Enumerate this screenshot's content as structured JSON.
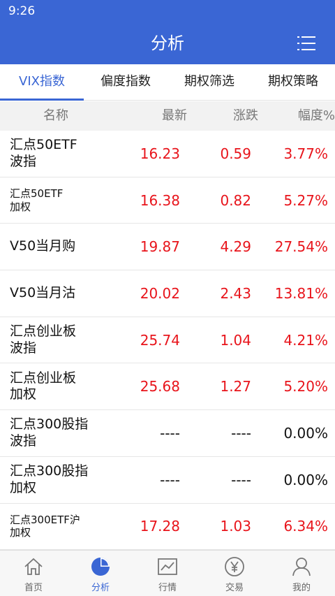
{
  "status_bar": {
    "time": "9:26"
  },
  "header": {
    "title": "分析",
    "menu_icon": "menu-icon"
  },
  "tabs": [
    {
      "label": "VIX指数",
      "active": true
    },
    {
      "label": "偏度指数",
      "active": false
    },
    {
      "label": "期权筛选",
      "active": false
    },
    {
      "label": "期权策略",
      "active": false
    }
  ],
  "table": {
    "headers": {
      "name": "名称",
      "latest": "最新",
      "change": "涨跌",
      "pct": "幅度%"
    },
    "rows": [
      {
        "name_line1": "汇点50ETF",
        "name_line2": "波指",
        "latest": "16.23",
        "change": "0.59",
        "pct": "3.77%",
        "color": "#e8141b"
      },
      {
        "name_line1": "汇点50ETF",
        "name_line2": "加权",
        "latest": "16.38",
        "change": "0.82",
        "pct": "5.27%",
        "color": "#e8141b"
      },
      {
        "name_line1": "V50当月购",
        "name_line2": "",
        "latest": "19.87",
        "change": "4.29",
        "pct": "27.54%",
        "color": "#e8141b"
      },
      {
        "name_line1": "V50当月沽",
        "name_line2": "",
        "latest": "20.02",
        "change": "2.43",
        "pct": "13.81%",
        "color": "#e8141b"
      },
      {
        "name_line1": "汇点创业板",
        "name_line2": "波指",
        "latest": "25.74",
        "change": "1.04",
        "pct": "4.21%",
        "color": "#e8141b"
      },
      {
        "name_line1": "汇点创业板",
        "name_line2": "加权",
        "latest": "25.68",
        "change": "1.27",
        "pct": "5.20%",
        "color": "#e8141b"
      },
      {
        "name_line1": "汇点300股指",
        "name_line2": "波指",
        "latest": "----",
        "change": "----",
        "pct": "0.00%",
        "color": "#111111"
      },
      {
        "name_line1": "汇点300股指",
        "name_line2": "加权",
        "latest": "----",
        "change": "----",
        "pct": "0.00%",
        "color": "#111111"
      },
      {
        "name_line1": "汇点300ETF沪",
        "name_line2": "加权",
        "latest": "17.28",
        "change": "1.03",
        "pct": "6.34%",
        "color": "#e8141b"
      }
    ]
  },
  "bottom_nav": [
    {
      "label": "首页",
      "icon": "home-icon",
      "active": false
    },
    {
      "label": "分析",
      "icon": "pie-chart-icon",
      "active": true
    },
    {
      "label": "行情",
      "icon": "line-chart-icon",
      "active": false
    },
    {
      "label": "交易",
      "icon": "yen-icon",
      "active": false
    },
    {
      "label": "我的",
      "icon": "user-icon",
      "active": false
    }
  ],
  "colors": {
    "accent": "#3a66d4",
    "up": "#e8141b",
    "neutral": "#111111"
  }
}
